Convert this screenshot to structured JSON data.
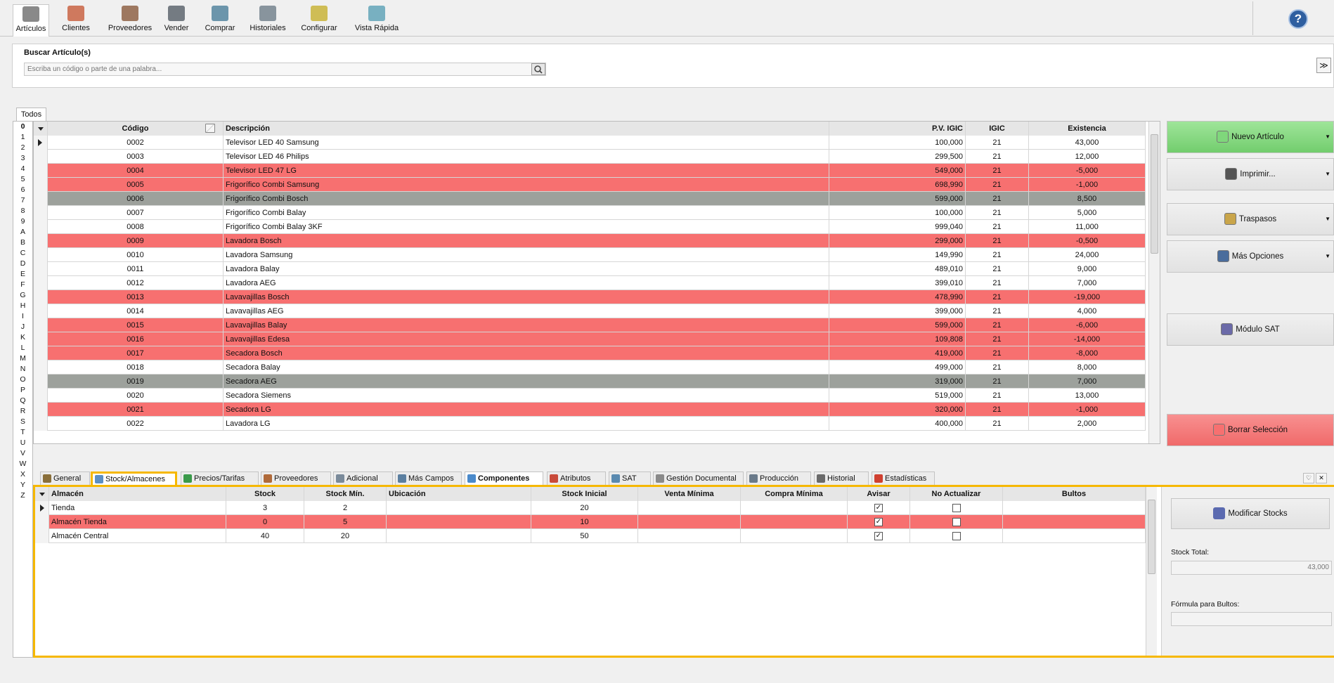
{
  "toolbar": {
    "items": [
      {
        "label": "Artículos",
        "icon": "articles-icon",
        "color": "#6b6b6b"
      },
      {
        "label": "Clientes",
        "icon": "clients-icon",
        "color": "#c75b39"
      },
      {
        "label": "Proveedores",
        "icon": "suppliers-icon",
        "color": "#8a5a3c"
      },
      {
        "label": "Vender",
        "icon": "sell-register-icon",
        "color": "#555e66"
      },
      {
        "label": "Comprar",
        "icon": "buy-register-icon",
        "color": "#4b7e9a"
      },
      {
        "label": "Historiales",
        "icon": "history-icon",
        "color": "#6e7d88"
      },
      {
        "label": "Configurar",
        "icon": "configure-icon",
        "color": "#c7b02e"
      },
      {
        "label": "Vista Rápida",
        "icon": "quick-view-icon",
        "color": "#5aa0b5"
      }
    ],
    "help_label": "?"
  },
  "search": {
    "title": "Buscar Artículo(s)",
    "placeholder": "Escriba un código o parte de una palabra..."
  },
  "collapse_label": "≫",
  "filter_tab": "Todos",
  "alphabet": [
    "0",
    "1",
    "2",
    "3",
    "4",
    "5",
    "6",
    "7",
    "8",
    "9",
    "A",
    "B",
    "C",
    "D",
    "E",
    "F",
    "G",
    "H",
    "I",
    "J",
    "K",
    "L",
    "M",
    "N",
    "O",
    "P",
    "Q",
    "R",
    "S",
    "T",
    "U",
    "V",
    "W",
    "X",
    "Y",
    "Z"
  ],
  "grid": {
    "columns": [
      "Código",
      "Descripción",
      "P.V. IGIC",
      "IGIC",
      "Existencia"
    ],
    "rows": [
      {
        "code": "0002",
        "desc": "Televisor LED 40 Samsung",
        "price": "100,000",
        "igic": "21",
        "stock": "43,000",
        "state": "white"
      },
      {
        "code": "0003",
        "desc": "Televisor LED 46 Philips",
        "price": "299,500",
        "igic": "21",
        "stock": "12,000",
        "state": "white"
      },
      {
        "code": "0004",
        "desc": "Televisor LED 47 LG",
        "price": "549,000",
        "igic": "21",
        "stock": "-5,000",
        "state": "red"
      },
      {
        "code": "0005",
        "desc": "Frigorífico Combi Samsung",
        "price": "698,990",
        "igic": "21",
        "stock": "-1,000",
        "state": "red"
      },
      {
        "code": "0006",
        "desc": "Frigorífico Combi Bosch",
        "price": "599,000",
        "igic": "21",
        "stock": "8,500",
        "state": "grey"
      },
      {
        "code": "0007",
        "desc": "Frigorífico Combi Balay",
        "price": "100,000",
        "igic": "21",
        "stock": "5,000",
        "state": "white"
      },
      {
        "code": "0008",
        "desc": "Frigorífico Combi Balay 3KF",
        "price": "999,040",
        "igic": "21",
        "stock": "11,000",
        "state": "white"
      },
      {
        "code": "0009",
        "desc": "Lavadora Bosch",
        "price": "299,000",
        "igic": "21",
        "stock": "-0,500",
        "state": "red"
      },
      {
        "code": "0010",
        "desc": "Lavadora Samsung",
        "price": "149,990",
        "igic": "21",
        "stock": "24,000",
        "state": "white"
      },
      {
        "code": "0011",
        "desc": "Lavadora Balay",
        "price": "489,010",
        "igic": "21",
        "stock": "9,000",
        "state": "white"
      },
      {
        "code": "0012",
        "desc": "Lavadora AEG",
        "price": "399,010",
        "igic": "21",
        "stock": "7,000",
        "state": "white"
      },
      {
        "code": "0013",
        "desc": "Lavavajillas Bosch",
        "price": "478,990",
        "igic": "21",
        "stock": "-19,000",
        "state": "red"
      },
      {
        "code": "0014",
        "desc": "Lavavajillas AEG",
        "price": "399,000",
        "igic": "21",
        "stock": "4,000",
        "state": "white"
      },
      {
        "code": "0015",
        "desc": "Lavavajillas Balay",
        "price": "599,000",
        "igic": "21",
        "stock": "-6,000",
        "state": "red"
      },
      {
        "code": "0016",
        "desc": "Lavavajillas Edesa",
        "price": "109,808",
        "igic": "21",
        "stock": "-14,000",
        "state": "red"
      },
      {
        "code": "0017",
        "desc": "Secadora Bosch",
        "price": "419,000",
        "igic": "21",
        "stock": "-8,000",
        "state": "red"
      },
      {
        "code": "0018",
        "desc": "Secadora Balay",
        "price": "499,000",
        "igic": "21",
        "stock": "8,000",
        "state": "white"
      },
      {
        "code": "0019",
        "desc": "Secadora AEG",
        "price": "319,000",
        "igic": "21",
        "stock": "7,000",
        "state": "grey"
      },
      {
        "code": "0020",
        "desc": "Secadora Siemens",
        "price": "519,000",
        "igic": "21",
        "stock": "13,000",
        "state": "white"
      },
      {
        "code": "0021",
        "desc": "Secadora LG",
        "price": "320,000",
        "igic": "21",
        "stock": "-1,000",
        "state": "red"
      },
      {
        "code": "0022",
        "desc": "Lavadora LG",
        "price": "400,000",
        "igic": "21",
        "stock": "2,000",
        "state": "white"
      }
    ]
  },
  "side_buttons": [
    {
      "label": "Nuevo Artículo",
      "icon": "new-article-icon",
      "color": "#7fd77b"
    },
    {
      "label": "Imprimir...",
      "icon": "printer-icon",
      "color": "#555"
    },
    {
      "label": "Traspasos",
      "icon": "transfer-icon",
      "color": "#c9a54a"
    },
    {
      "label": "Más Opciones",
      "icon": "more-options-icon",
      "color": "#4a6d9c"
    },
    {
      "label": "Módulo SAT",
      "icon": "sat-module-icon",
      "color": "#6b6aa8"
    },
    {
      "label": "Borrar Selección",
      "icon": "delete-selection-icon",
      "color": "#f77070"
    }
  ],
  "bottom_tabs": [
    {
      "label": "General",
      "icon": "general-tab-icon",
      "color": "#8a6f3a"
    },
    {
      "label": "Stock/Almacenes",
      "icon": "stock-warehouses-tab-icon",
      "color": "#5b8fc4"
    },
    {
      "label": "Precios/Tarifas",
      "icon": "prices-tab-icon",
      "color": "#3a9a4a"
    },
    {
      "label": "Proveedores",
      "icon": "suppliers-tab-icon",
      "color": "#b06a3a"
    },
    {
      "label": "Adicional",
      "icon": "additional-tab-icon",
      "color": "#7a8a9a"
    },
    {
      "label": "Más Campos",
      "icon": "more-fields-tab-icon",
      "color": "#5b7fa0"
    },
    {
      "label": "Componentes",
      "icon": "components-tab-icon",
      "color": "#4a8acb"
    },
    {
      "label": "Atributos",
      "icon": "attributes-tab-icon",
      "color": "#c94a3a"
    },
    {
      "label": "SAT",
      "icon": "sat-tab-icon",
      "color": "#5a8ab0"
    },
    {
      "label": "Gestión Documental",
      "icon": "documents-tab-icon",
      "color": "#8a8a8a"
    },
    {
      "label": "Producción",
      "icon": "production-tab-icon",
      "color": "#6a7a8a"
    },
    {
      "label": "Historial",
      "icon": "history-tab-icon",
      "color": "#6a6a6a"
    },
    {
      "label": "Estadísticas",
      "icon": "statistics-tab-icon",
      "color": "#d04030"
    }
  ],
  "stock_grid": {
    "columns": [
      "Almacén",
      "Stock",
      "Stock Mín.",
      "Ubicación",
      "Stock Inicial",
      "Venta Mínima",
      "Compra Mínima",
      "Avisar",
      "No Actualizar",
      "Bultos"
    ],
    "rows": [
      {
        "name": "Tienda",
        "stock": "3",
        "min": "2",
        "loc": "",
        "initial": "20",
        "sale_min": "",
        "buy_min": "",
        "warn": true,
        "no_update": false,
        "packs": "",
        "state": "white"
      },
      {
        "name": "Almacén Tienda",
        "stock": "0",
        "min": "5",
        "loc": "",
        "initial": "10",
        "sale_min": "",
        "buy_min": "",
        "warn": true,
        "no_update": false,
        "packs": "",
        "state": "red"
      },
      {
        "name": "Almacén Central",
        "stock": "40",
        "min": "20",
        "loc": "",
        "initial": "50",
        "sale_min": "",
        "buy_min": "",
        "warn": true,
        "no_update": false,
        "packs": "",
        "state": "white"
      }
    ]
  },
  "stock_info": {
    "modify_label": "Modificar Stocks",
    "modify_icon": "modify-stocks-icon",
    "total_label": "Stock Total:",
    "total_value": "43,000",
    "formula_label": "Fórmula para Bultos:",
    "formula_value": ""
  },
  "colors": {
    "highlight": "#f6b800",
    "red_row": "#f77070",
    "grey_row": "#9da19c"
  }
}
